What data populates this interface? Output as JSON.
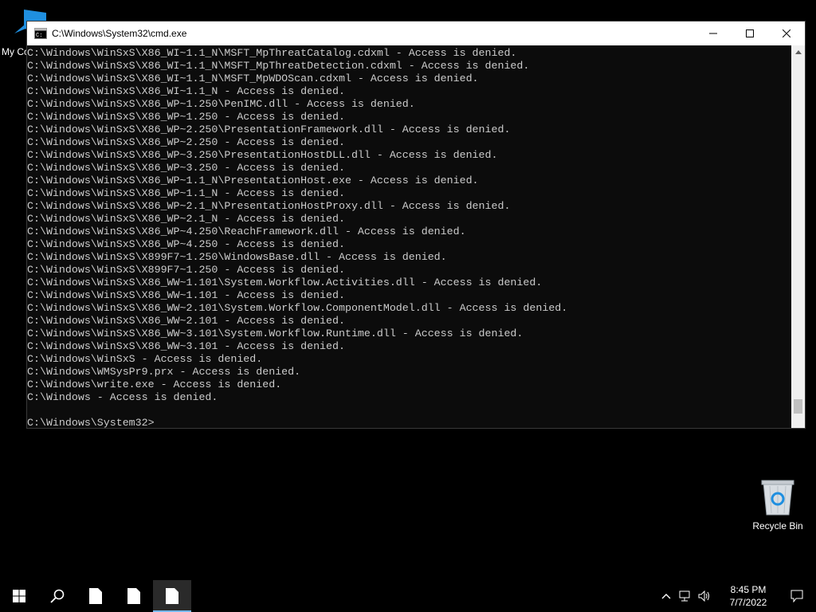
{
  "desktop": {
    "icons": [
      {
        "label": "My Co"
      },
      {
        "label": "Recycle Bin"
      }
    ]
  },
  "window": {
    "title": "C:\\Windows\\System32\\cmd.exe",
    "lines": [
      "C:\\Windows\\WinSxS\\X86_WI~1.1_N\\MSFT_MpThreatCatalog.cdxml - Access is denied.",
      "C:\\Windows\\WinSxS\\X86_WI~1.1_N\\MSFT_MpThreatDetection.cdxml - Access is denied.",
      "C:\\Windows\\WinSxS\\X86_WI~1.1_N\\MSFT_MpWDOScan.cdxml - Access is denied.",
      "C:\\Windows\\WinSxS\\X86_WI~1.1_N - Access is denied.",
      "C:\\Windows\\WinSxS\\X86_WP~1.250\\PenIMC.dll - Access is denied.",
      "C:\\Windows\\WinSxS\\X86_WP~1.250 - Access is denied.",
      "C:\\Windows\\WinSxS\\X86_WP~2.250\\PresentationFramework.dll - Access is denied.",
      "C:\\Windows\\WinSxS\\X86_WP~2.250 - Access is denied.",
      "C:\\Windows\\WinSxS\\X86_WP~3.250\\PresentationHostDLL.dll - Access is denied.",
      "C:\\Windows\\WinSxS\\X86_WP~3.250 - Access is denied.",
      "C:\\Windows\\WinSxS\\X86_WP~1.1_N\\PresentationHost.exe - Access is denied.",
      "C:\\Windows\\WinSxS\\X86_WP~1.1_N - Access is denied.",
      "C:\\Windows\\WinSxS\\X86_WP~2.1_N\\PresentationHostProxy.dll - Access is denied.",
      "C:\\Windows\\WinSxS\\X86_WP~2.1_N - Access is denied.",
      "C:\\Windows\\WinSxS\\X86_WP~4.250\\ReachFramework.dll - Access is denied.",
      "C:\\Windows\\WinSxS\\X86_WP~4.250 - Access is denied.",
      "C:\\Windows\\WinSxS\\X899F7~1.250\\WindowsBase.dll - Access is denied.",
      "C:\\Windows\\WinSxS\\X899F7~1.250 - Access is denied.",
      "C:\\Windows\\WinSxS\\X86_WW~1.101\\System.Workflow.Activities.dll - Access is denied.",
      "C:\\Windows\\WinSxS\\X86_WW~1.101 - Access is denied.",
      "C:\\Windows\\WinSxS\\X86_WW~2.101\\System.Workflow.ComponentModel.dll - Access is denied.",
      "C:\\Windows\\WinSxS\\X86_WW~2.101 - Access is denied.",
      "C:\\Windows\\WinSxS\\X86_WW~3.101\\System.Workflow.Runtime.dll - Access is denied.",
      "C:\\Windows\\WinSxS\\X86_WW~3.101 - Access is denied.",
      "C:\\Windows\\WinSxS - Access is denied.",
      "C:\\Windows\\WMSysPr9.prx - Access is denied.",
      "C:\\Windows\\write.exe - Access is denied.",
      "C:\\Windows - Access is denied.",
      "",
      "C:\\Windows\\System32>"
    ]
  },
  "taskbar": {
    "clock": {
      "time": "8:45 PM",
      "date": "7/7/2022"
    }
  }
}
